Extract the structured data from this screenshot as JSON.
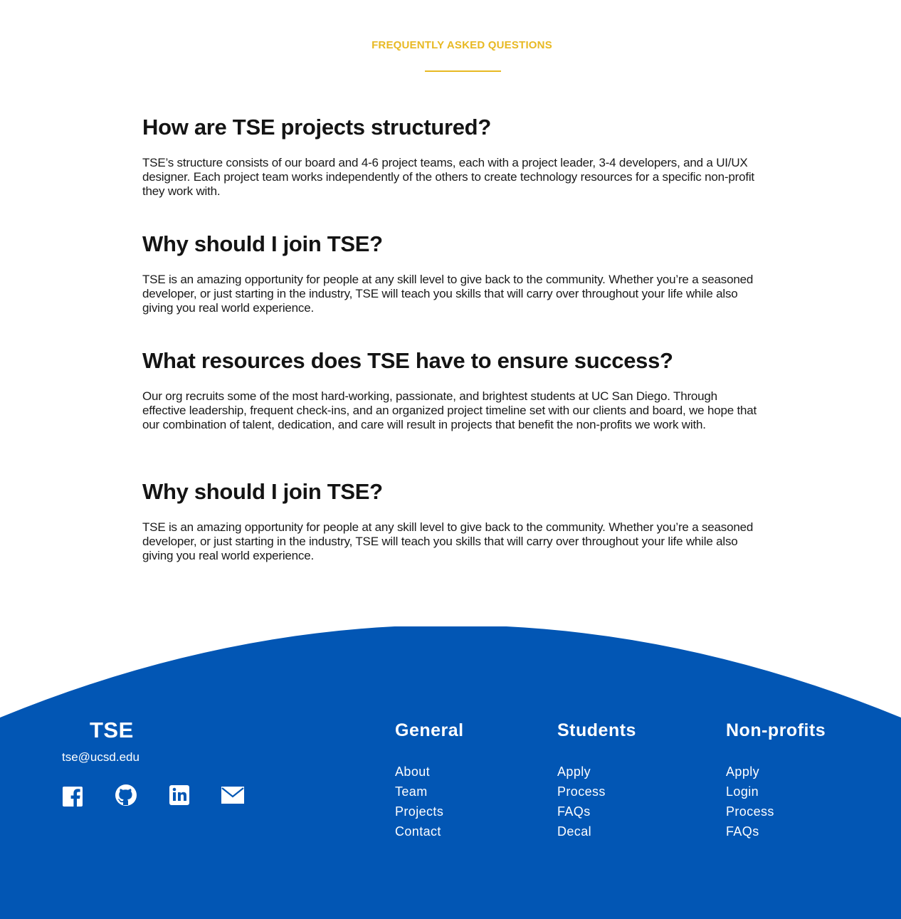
{
  "faq": {
    "eyebrow": "FREQUENTLY ASKED QUESTIONS",
    "items": [
      {
        "question": "How are TSE projects structured?",
        "answer": "TSE’s structure consists of our board and 4-6 project teams, each with a project leader, 3-4 developers, and a UI/UX designer. Each project team works independently of the others to create technology resources for a specific non-profit they work with."
      },
      {
        "question": "Why should I join TSE?",
        "answer": "TSE is an amazing opportunity for people at any skill level to give back to the community. Whether you’re a seasoned developer, or just starting in the industry, TSE will teach you skills that will carry over throughout your life while also giving you real world experience."
      },
      {
        "question": "What resources does TSE have to ensure success?",
        "answer": "Our org recruits some of the most hard-working, passionate, and brightest students at UC San Diego. Through effective leadership, frequent check-ins, and an organized project timeline set with our clients and board, we hope that our combination of talent, dedication, and care will result in projects that benefit the non-profits we work with."
      },
      {
        "question": "Why should I join TSE?",
        "answer": "TSE is an amazing opportunity for people at any skill level to give back to the community. Whether you’re a seasoned developer, or just starting in the industry, TSE will teach you skills that will carry over throughout your life while also giving you real world experience."
      }
    ]
  },
  "footer": {
    "brand": "TSE",
    "email": "tse@ucsd.edu",
    "background_color": "#0256b4",
    "socials": [
      "facebook-icon",
      "github-icon",
      "linkedin-icon",
      "mail-icon"
    ],
    "columns": [
      {
        "title": "General",
        "links": [
          "About",
          "Team",
          "Projects",
          "Contact"
        ]
      },
      {
        "title": "Students",
        "links": [
          "Apply",
          "Process",
          "FAQs",
          "Decal"
        ]
      },
      {
        "title": "Non-profits",
        "links": [
          "Apply",
          "Login",
          "Process",
          "FAQs"
        ]
      }
    ]
  },
  "colors": {
    "accent": "#e8b923",
    "heading": "#141414",
    "footer_text": "#ffffff"
  }
}
